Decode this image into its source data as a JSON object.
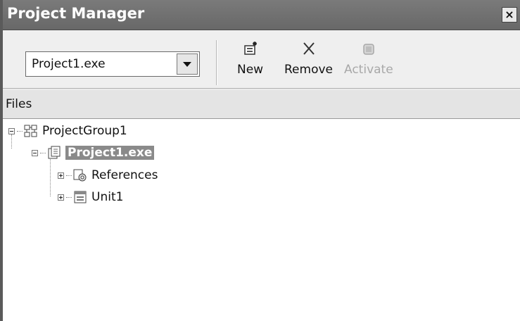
{
  "window": {
    "title": "Project Manager",
    "close_glyph": "×"
  },
  "toolbar": {
    "project_select": {
      "value": "Project1.exe"
    },
    "buttons": [
      {
        "label": "New",
        "icon": "new-project-icon",
        "enabled": true
      },
      {
        "label": "Remove",
        "icon": "remove-icon",
        "enabled": true
      },
      {
        "label": "Activate",
        "icon": "activate-icon",
        "enabled": false
      }
    ]
  },
  "files_header": {
    "label": "Files"
  },
  "tree": {
    "nodes": [
      {
        "label": "ProjectGroup1",
        "icon": "project-group-icon",
        "expanded": true,
        "level": 0
      },
      {
        "label": "Project1.exe",
        "icon": "project-icon",
        "expanded": true,
        "level": 1,
        "selected": true
      },
      {
        "label": "References",
        "icon": "references-icon",
        "expanded": false,
        "level": 2
      },
      {
        "label": "Unit1",
        "icon": "unit-form-icon",
        "expanded": false,
        "level": 2
      }
    ]
  },
  "colors": {
    "title_bar": "#707070",
    "selection": "#8a8a8a",
    "tree_bg": "#ffffff"
  }
}
